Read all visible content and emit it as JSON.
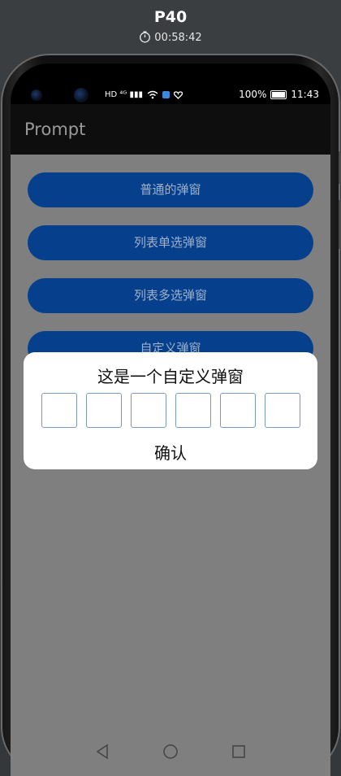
{
  "device": {
    "name": "P40",
    "timer": "00:58:42"
  },
  "statusbar": {
    "left_icons": "HD ⁴ᴳ ▮▮▮",
    "battery_percent": "100%",
    "time": "11:43"
  },
  "app": {
    "title": "Prompt"
  },
  "buttons": [
    {
      "label": "普通的弹窗"
    },
    {
      "label": "列表单选弹窗"
    },
    {
      "label": "列表多选弹窗"
    },
    {
      "label": "自定义弹窗"
    }
  ],
  "dialog": {
    "title": "这是一个自定义弹窗",
    "code_boxes": [
      "",
      "",
      "",
      "",
      "",
      ""
    ],
    "confirm_label": "确认"
  },
  "colors": {
    "button_bg": "#06408c",
    "overlay": "#7f7f7f",
    "dialog_bg": "#ffffff"
  }
}
